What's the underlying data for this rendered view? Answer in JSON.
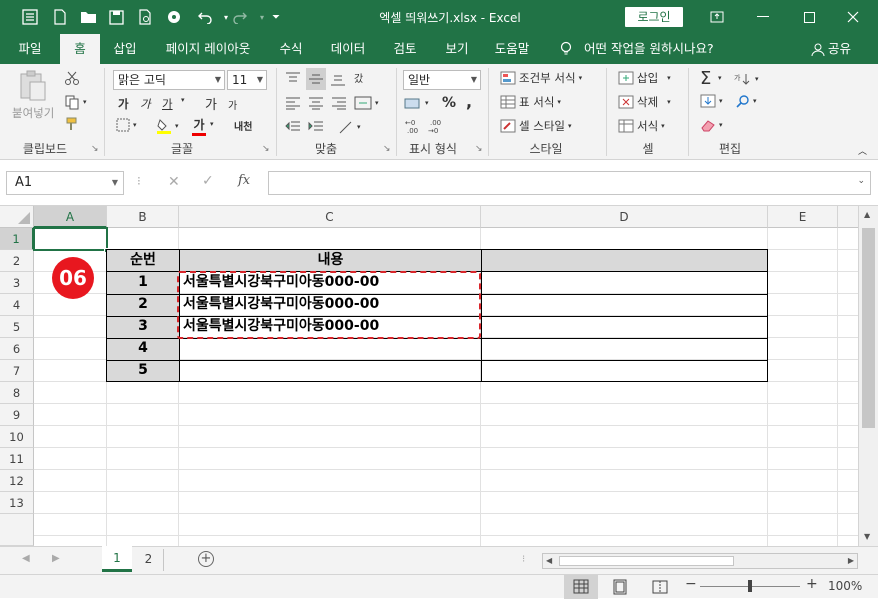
{
  "window": {
    "title": "엑셀 띄워쓰기.xlsx  -  Excel",
    "login_label": "로그인",
    "restore_symbol": "⬜"
  },
  "tabs": [
    "파일",
    "홈",
    "삽입",
    "페이지 레이아웃",
    "수식",
    "데이터",
    "검토",
    "보기",
    "도움말"
  ],
  "tell_me": "어떤 작업을 원하시나요?",
  "share_label": "공유",
  "ribbon": {
    "clipboard": {
      "paste_label": "붙여넣기",
      "group": "클립보드"
    },
    "font": {
      "name": "맑은 고딕",
      "size": "11",
      "group": "글꼴",
      "bold": "가",
      "italic": "가",
      "underline": "가",
      "grow": "가",
      "shrink": "가",
      "phonetic": "내천"
    },
    "align": {
      "group": "맞춤",
      "wrap": "갔"
    },
    "number": {
      "format": "일반",
      "group": "표시 형식",
      "percent": "%",
      "comma": ","
    },
    "styles": {
      "conditional": "조건부 서식",
      "table": "표 서식",
      "cell": "셀 스타일",
      "group": "스타일"
    },
    "cells": {
      "insert": "삽입",
      "delete": "삭제",
      "format": "서식",
      "group": "셀"
    },
    "editing": {
      "group": "편집",
      "sum": "Σ"
    }
  },
  "formula_bar": {
    "name_box": "A1",
    "fx": "fx",
    "formula": ""
  },
  "columns": [
    "A",
    "B",
    "C",
    "D",
    "E"
  ],
  "rows": [
    "1",
    "2",
    "3",
    "4",
    "5",
    "6",
    "7",
    "8",
    "9",
    "10",
    "11",
    "12",
    "13"
  ],
  "table": {
    "header_no": "순번",
    "header_content": "내용",
    "nums": [
      "1",
      "2",
      "3",
      "4",
      "5"
    ],
    "contents": [
      "서울특별시강북구미아동000-00",
      "서울특별시강북구미아동000-00",
      "서울특별시강북구미아동000-00",
      "",
      ""
    ]
  },
  "step_badge": "06",
  "sheets": [
    "1",
    "2"
  ],
  "status": {
    "zoom": "100%",
    "minus": "−",
    "plus": "+"
  },
  "colors": {
    "accent": "#217346",
    "badge": "#e8171f",
    "highlight_border": "#d9262b"
  }
}
